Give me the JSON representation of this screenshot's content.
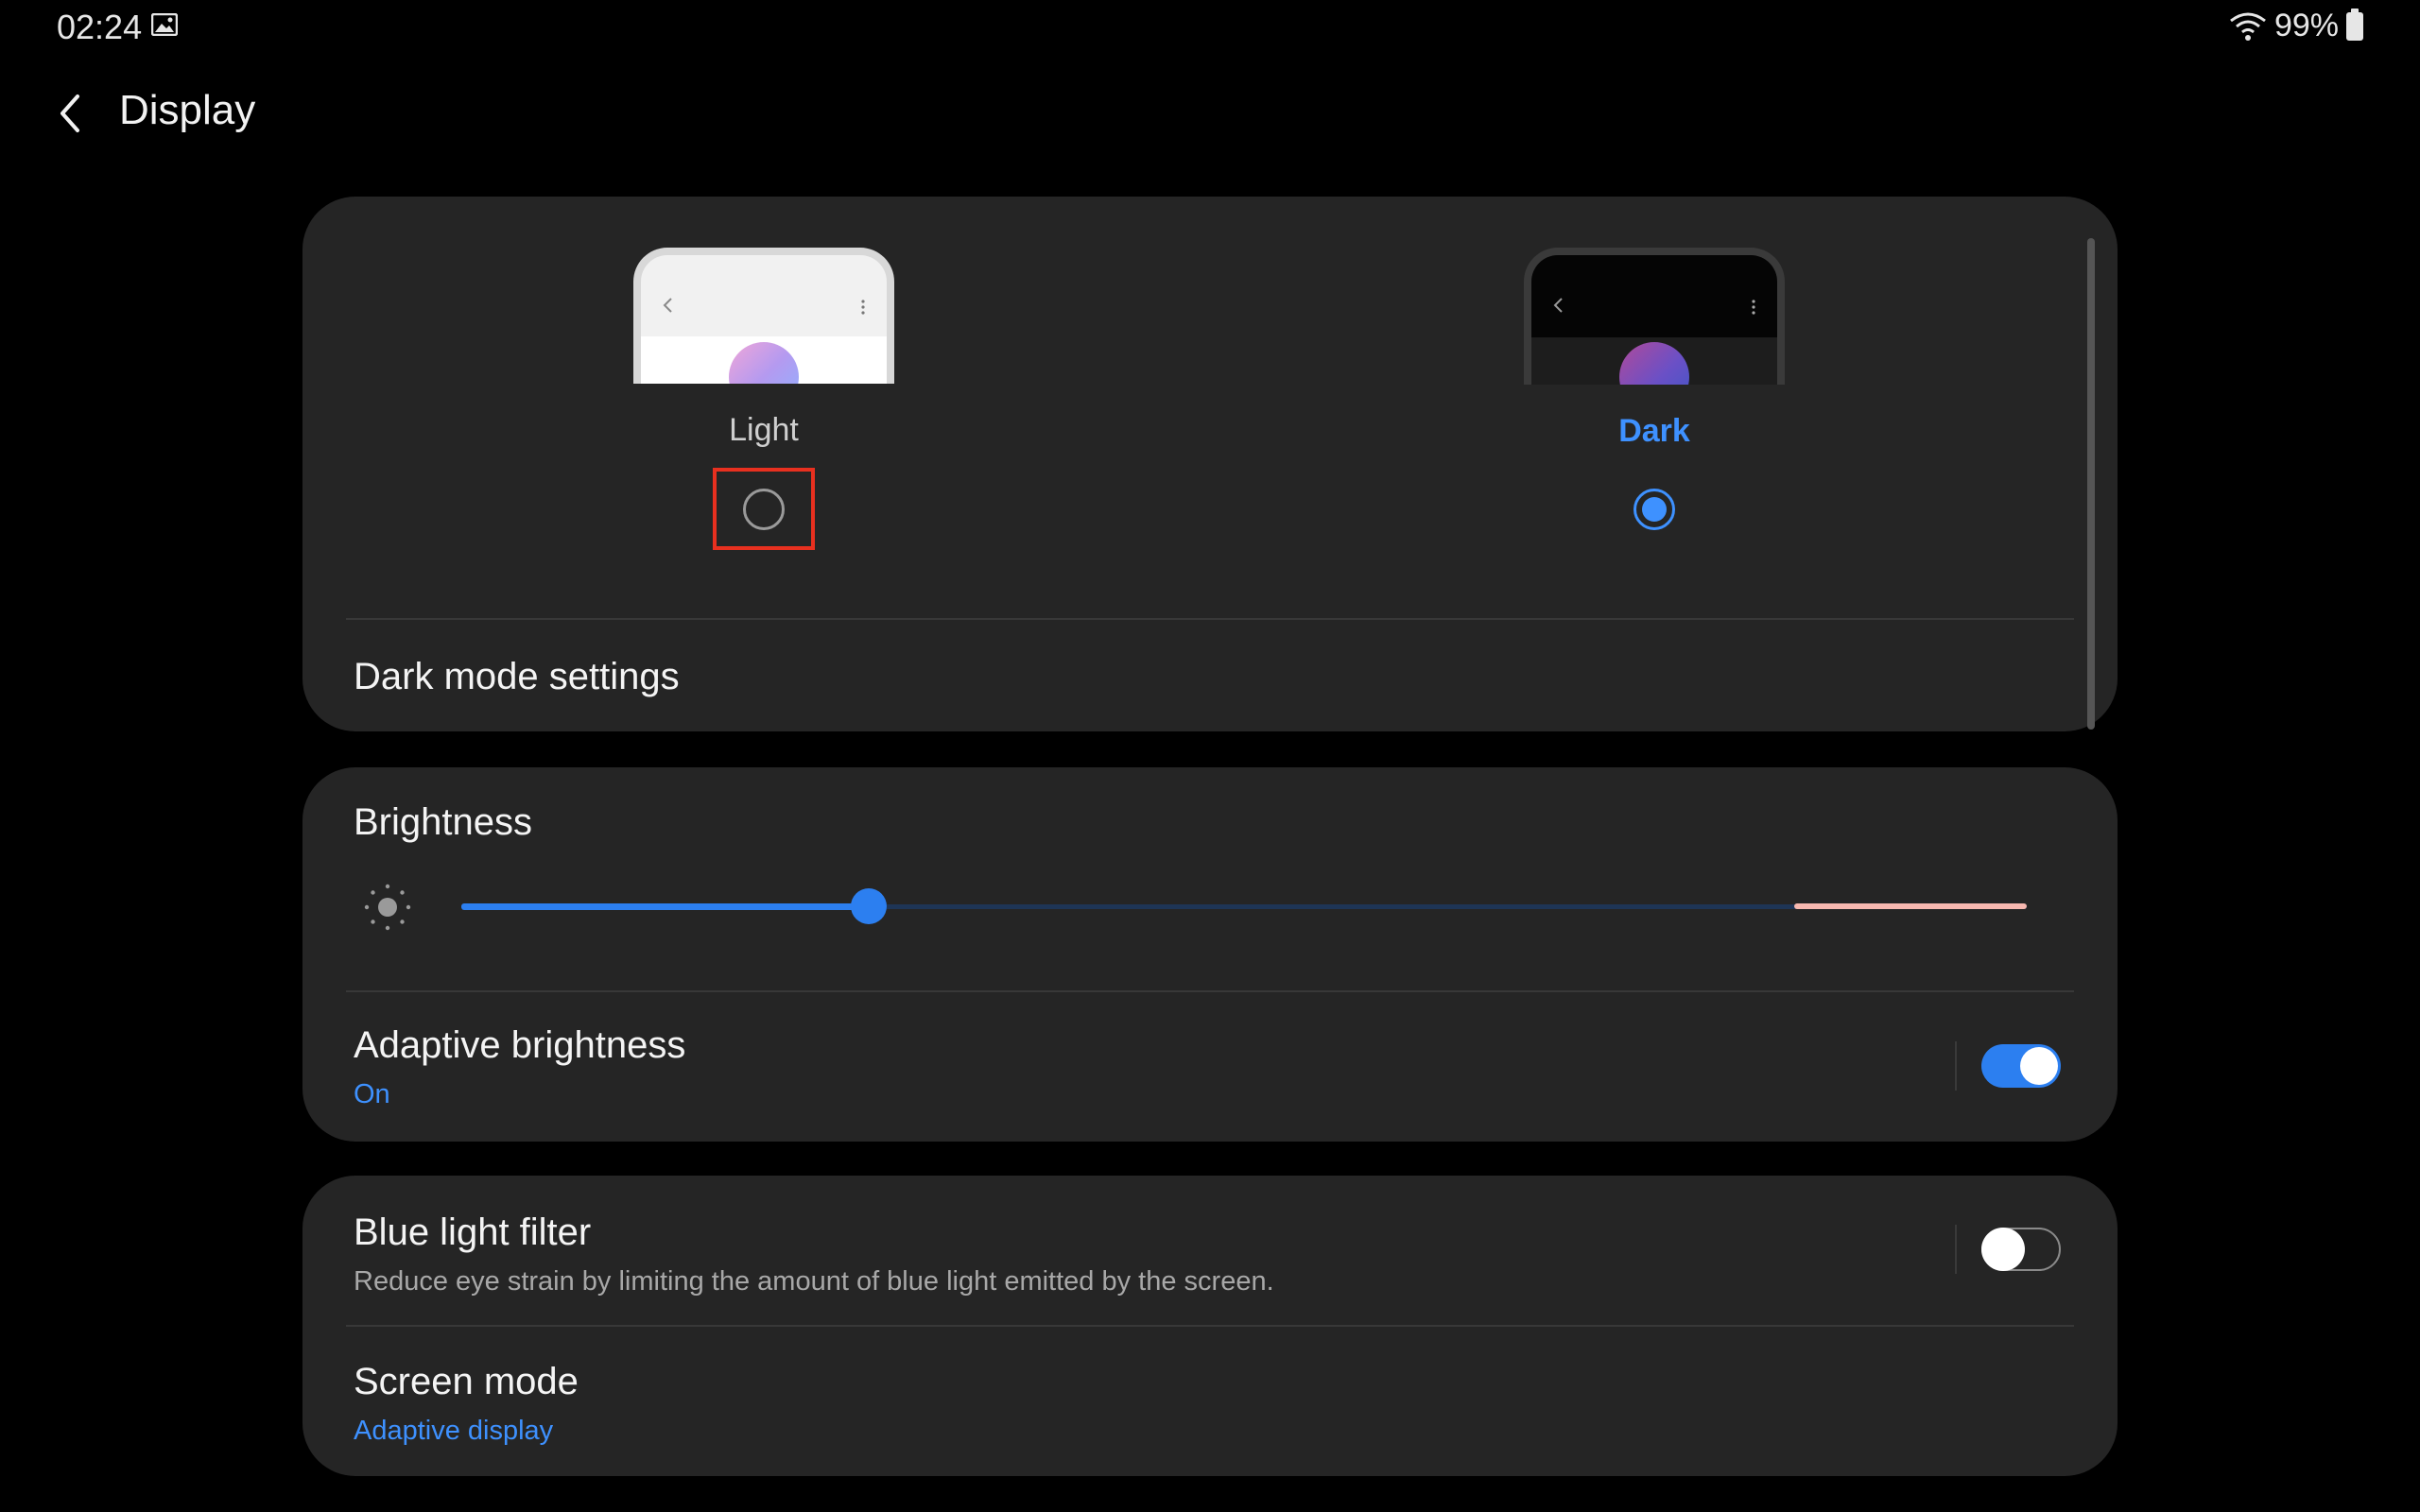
{
  "status_bar": {
    "time": "02:24",
    "battery": "99%",
    "icons": [
      "image-icon",
      "wifi-icon",
      "battery-icon"
    ]
  },
  "header": {
    "title": "Display"
  },
  "theme": {
    "light_label": "Light",
    "dark_label": "Dark",
    "selected": "Dark",
    "dark_mode_settings": "Dark mode settings"
  },
  "brightness": {
    "title": "Brightness",
    "level": 0.26
  },
  "adaptive_brightness": {
    "title": "Adaptive brightness",
    "status": "On",
    "enabled": true
  },
  "blue_light_filter": {
    "title": "Blue light filter",
    "description": "Reduce eye strain by limiting the amount of blue light emitted by the screen.",
    "enabled": false
  },
  "screen_mode": {
    "title": "Screen mode",
    "value": "Adaptive display"
  },
  "colors": {
    "accent": "#3e91ff",
    "card_bg": "#252525",
    "highlight_box": "#e8301f"
  }
}
